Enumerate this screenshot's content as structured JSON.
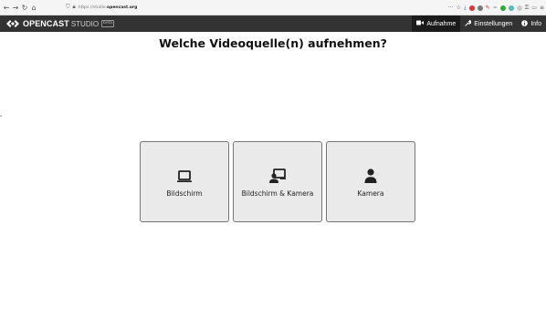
{
  "browser": {
    "url_prefix": "https://studio.",
    "url_host": "opencast.org",
    "menu_glyph": "···"
  },
  "app": {
    "logo_text": "OPENCAST",
    "logo_sub": "STUDIO",
    "beta_badge": "beta",
    "nav": [
      {
        "label": "Aufnahme",
        "icon": "video-camera-icon",
        "active": true
      },
      {
        "label": "Einstellungen",
        "icon": "wrench-icon",
        "active": false
      },
      {
        "label": "Info",
        "icon": "info-icon",
        "active": false
      }
    ]
  },
  "main": {
    "title": "Welche Videoquelle(n) aufnehmen?",
    "sources": [
      {
        "label": "Bildschirm",
        "icon": "monitor-icon"
      },
      {
        "label": "Bildschirm & Kamera",
        "icon": "screen-and-user-icon"
      },
      {
        "label": "Kamera",
        "icon": "user-icon"
      }
    ]
  },
  "colors": {
    "header_bg": "#333333",
    "active_tab_bg": "#1b1b1b",
    "tile_bg": "#eaeaea"
  }
}
